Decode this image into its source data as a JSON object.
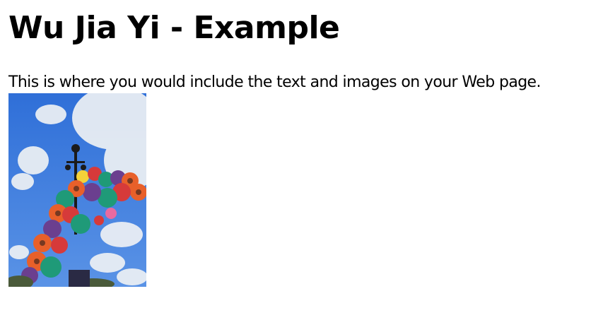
{
  "page": {
    "heading": "Wu Jia Yi - Example",
    "body_text": "This is where you would include the text and images on your Web page."
  },
  "image": {
    "subject": "balloon-bunch-photo",
    "colors": {
      "sky": "#3f7fe0",
      "cloud": "#e9eef4",
      "orange": "#e8602a",
      "green": "#1f9a78",
      "purple": "#6b3f8f",
      "yellow": "#f4d23a",
      "red": "#d63a3a"
    }
  }
}
